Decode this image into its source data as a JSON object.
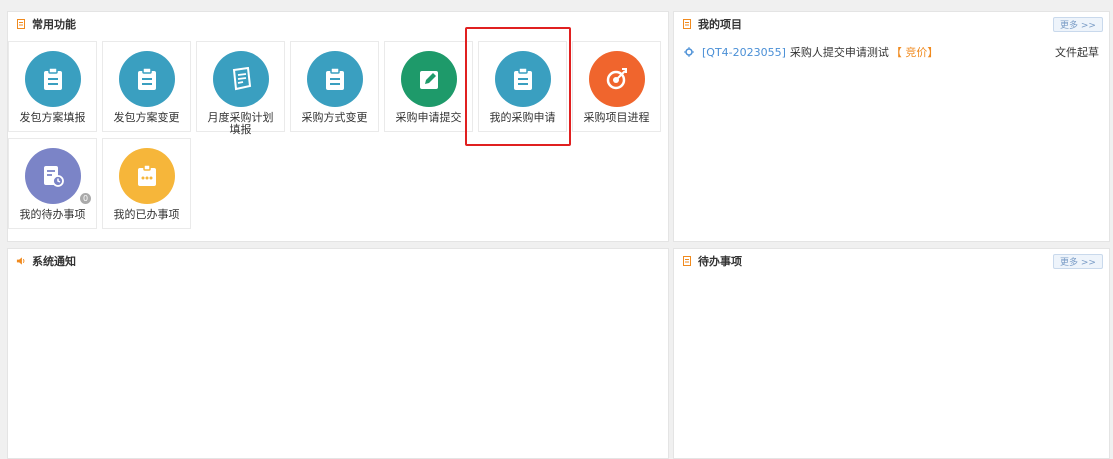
{
  "common": {
    "title": "常用功能",
    "tiles": [
      {
        "label": "发包方案填报",
        "color": "#3a9fc0",
        "icon": "clipboard-icon"
      },
      {
        "label": "发包方案变更",
        "color": "#3a9fc0",
        "icon": "clipboard-icon"
      },
      {
        "label": "月度采购计划填报",
        "color": "#3a9fc0",
        "icon": "document-list-icon"
      },
      {
        "label": "采购方式变更",
        "color": "#3a9fc0",
        "icon": "clipboard-icon"
      },
      {
        "label": "采购申请提交",
        "color": "#1e9a6a",
        "icon": "pencil-edit-icon"
      },
      {
        "label": "我的采购申请",
        "color": "#3a9fc0",
        "icon": "clipboard-icon"
      },
      {
        "label": "采购项目进程",
        "color": "#f0652d",
        "icon": "target-icon"
      },
      {
        "label": "我的待办事项",
        "color": "#7b84c7",
        "icon": "task-clock-icon",
        "badge": "0"
      },
      {
        "label": "我的已办事项",
        "color": "#f6b63a",
        "icon": "done-clipboard-icon"
      }
    ]
  },
  "projects": {
    "title": "我的项目",
    "more": "更多 >>",
    "items": [
      {
        "code": "[QT4-2023055]",
        "title": "采购人提交申请测试",
        "tag": "【 竞价】",
        "status": "文件起草"
      }
    ]
  },
  "notices": {
    "title": "系统通知"
  },
  "todo": {
    "title": "待办事项",
    "more": "更多 >>"
  },
  "colors": {
    "accent": "#4a8fd6",
    "highlight": "#e02020",
    "tag": "#f08a1e"
  }
}
